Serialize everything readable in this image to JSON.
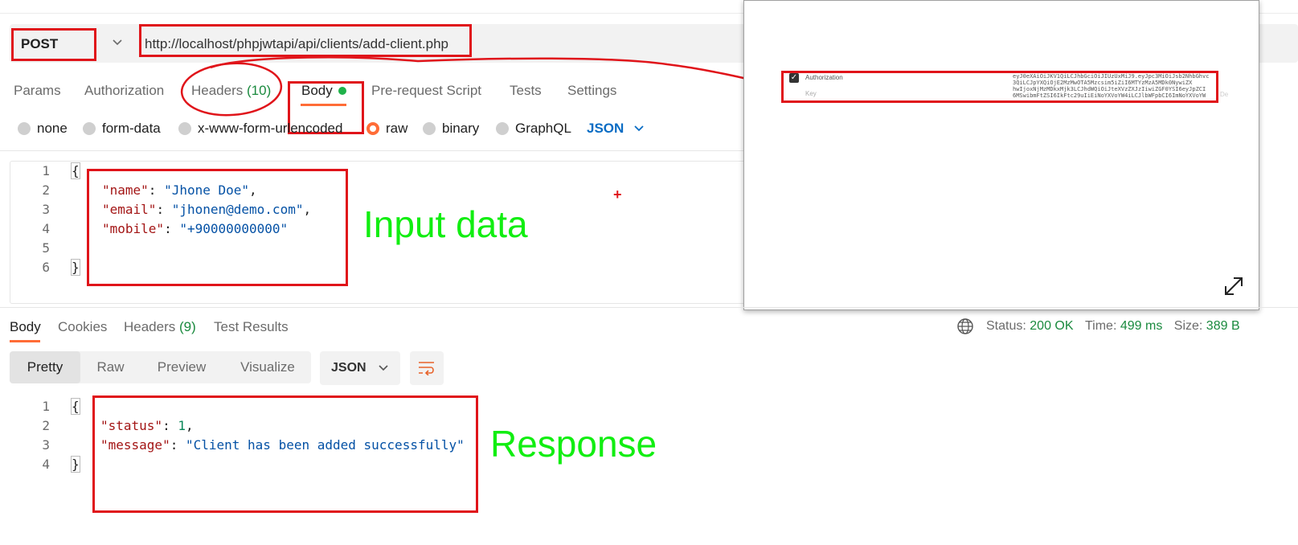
{
  "request": {
    "method": "POST",
    "url": "http://localhost/phpjwtapi/api/clients/add-client.php"
  },
  "req_tabs": {
    "params": "Params",
    "authorization": "Authorization",
    "headers": "Headers",
    "headers_count": "(10)",
    "body": "Body",
    "prerequest": "Pre-request Script",
    "tests": "Tests",
    "settings": "Settings"
  },
  "body_types": {
    "none": "none",
    "form_data": "form-data",
    "urlencoded": "x-www-form-urlencoded",
    "raw": "raw",
    "binary": "binary",
    "graphql": "GraphQL",
    "format": "JSON"
  },
  "request_body": {
    "line_numbers": [
      "1",
      "2",
      "3",
      "4",
      "5",
      "6"
    ],
    "open_brace": "{",
    "close_brace": "}",
    "name_key": "\"name\"",
    "name_val": "\"Jhone Doe\"",
    "email_key": "\"email\"",
    "email_val": "\"jhonen@demo.com\"",
    "mobile_key": "\"mobile\"",
    "mobile_val": "\"+90000000000\""
  },
  "annotations": {
    "input": "Input data",
    "response": "Response"
  },
  "overlay": {
    "row1_label": "Authorization",
    "row2_placeholder": "Key",
    "token_lines": [
      "eyJ0eXAiOiJKV1QiLCJhbGciOiJIUzUxMiJ9.eyJpc3MiOiJsb2NhbGhvc",
      "3QiLCJpYXQiOjE2MzMwOTA5Mzcsim5iZiI6MTYzMzA5MDk0NywiZX",
      "hwIjoxNjMzMDkxMjk3LCJhdWQiOiJteXVzZXJzIiwiZGF0YSI6eyJpZCI",
      "6MSwibmFtZSI6IkFtc29uIiEiNoYXVoYW4iLCJlbWFpbCI6ImNoYXVoYW"
    ],
    "cut_text": "De"
  },
  "resp_tabs": {
    "body": "Body",
    "cookies": "Cookies",
    "headers": "Headers",
    "headers_count": "(9)",
    "test_results": "Test Results"
  },
  "resp_status": {
    "status_label": "Status:",
    "status_val": "200 OK",
    "time_label": "Time:",
    "time_val": "499 ms",
    "size_label": "Size:",
    "size_val": "389 B"
  },
  "resp_view": {
    "pretty": "Pretty",
    "raw": "Raw",
    "preview": "Preview",
    "visualize": "Visualize",
    "format": "JSON"
  },
  "response_body": {
    "line_numbers": [
      "1",
      "2",
      "3",
      "4"
    ],
    "open_brace": "{",
    "close_brace": "}",
    "status_key": "\"status\"",
    "status_val": "1",
    "message_key": "\"message\"",
    "message_val": "\"Client has been added successfully\""
  },
  "colors": {
    "accent": "#ff6c37",
    "annotation_red": "#e0141a",
    "annotation_green": "#11ee11",
    "status_green": "#1a8a3e",
    "json_blue": "#0a6cc4"
  }
}
